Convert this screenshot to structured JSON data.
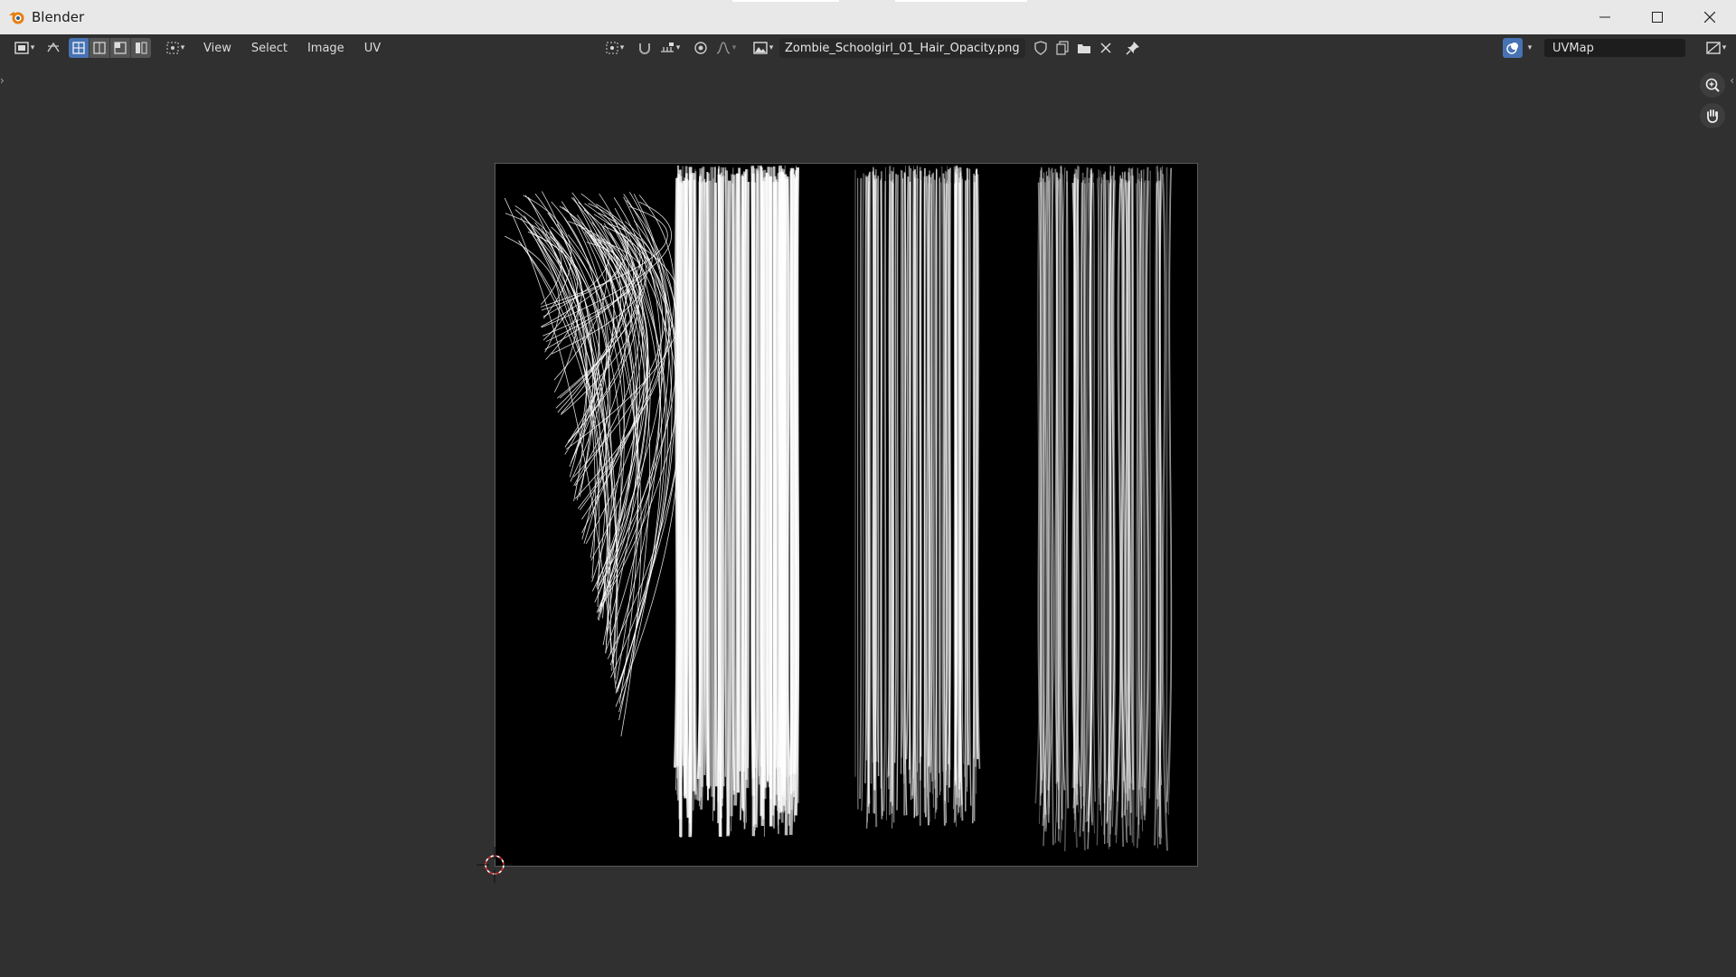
{
  "window": {
    "title": "Blender",
    "minimize_icon": "minimize-icon",
    "maximize_icon": "maximize-icon",
    "close_icon": "close-icon"
  },
  "header": {
    "editor_type_icon": "image-editor-icon",
    "menus": [
      "View",
      "Select",
      "Image",
      "UV"
    ],
    "image_name": "Zombie_Schoolgirl_01_Hair_Opacity.png",
    "uv_map": "UVMap",
    "accent_color": "#4772b3"
  },
  "viewport": {
    "image_content": "hair-opacity-texture"
  }
}
